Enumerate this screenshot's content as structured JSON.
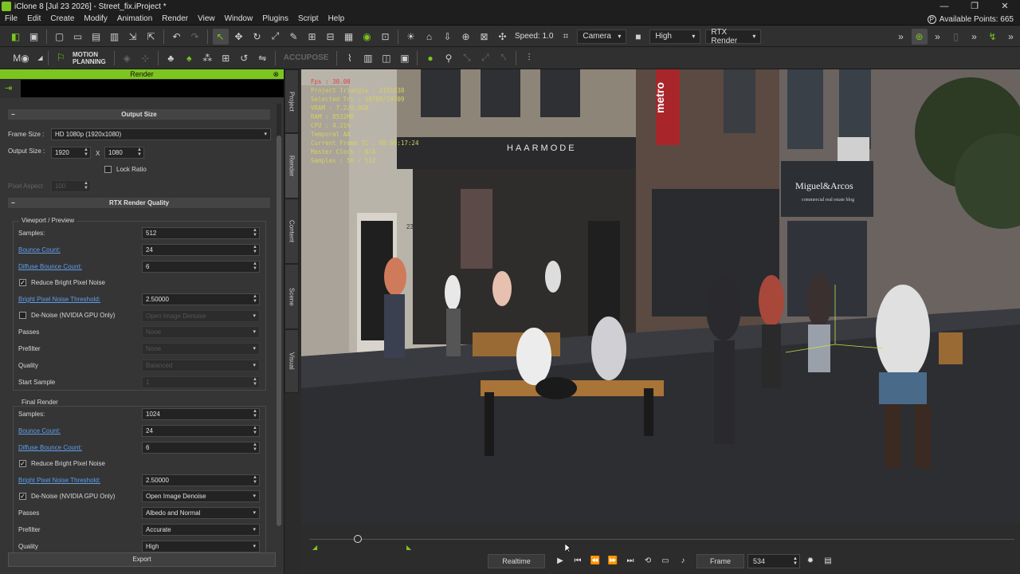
{
  "window": {
    "title": "iClone 8 [Jul 23 2026] - Street_fix.iProject *",
    "controls": [
      "—",
      "❐",
      "✕"
    ]
  },
  "menu": {
    "items": [
      "File",
      "Edit",
      "Create",
      "Modify",
      "Animation",
      "Render",
      "View",
      "Window",
      "Plugins",
      "Script",
      "Help"
    ],
    "points_label": "Available Points: 665",
    "points_icon": "P"
  },
  "toolbar": {
    "speed_label": "Speed: 1.0",
    "camera_value": "Camera",
    "quality_value": "High",
    "render_mode_value": "RTX Render",
    "motion_planning_line1": "MOTION",
    "motion_planning_line2": "PLANNING",
    "accupose_label": "ACCUPOSE"
  },
  "render_panel": {
    "title": "Render",
    "output_size": {
      "header": "Output Size",
      "frame_size_label": "Frame Size :",
      "frame_size_value": "HD 1080p (1920x1080)",
      "output_size_label": "Output Size :",
      "width": "1920",
      "times": "X",
      "height": "1080",
      "lock_ratio_label": "Lock Ratio",
      "pixel_aspect_label": "Pixel Aspect",
      "pixel_aspect_value": "100"
    },
    "rtx_quality": {
      "header": "RTX Render Quality",
      "viewport": {
        "title": "Viewport / Preview",
        "samples_label": "Samples:",
        "samples_value": "512",
        "bounce_label": "Bounce Count:",
        "bounce_value": "24",
        "diffuse_label": "Diffuse Bounce Count:",
        "diffuse_value": "6",
        "reduce_noise_label": "Reduce Bright Pixel Noise",
        "reduce_noise_checked": true,
        "threshold_label": "Bright Pixel Noise Threshold:",
        "threshold_value": "2.50000",
        "denoise_label": "De-Noise (NVIDIA GPU Only)",
        "denoise_checked": false,
        "denoise_value": "Open Image Denoise",
        "passes_label": "Passes",
        "passes_value": "None",
        "prefilter_label": "Prefilter",
        "prefilter_value": "None",
        "quality_label": "Quality",
        "quality_value": "Balanced",
        "start_sample_label": "Start Sample",
        "start_sample_value": "1"
      },
      "final": {
        "title": "Final Render",
        "samples_label": "Samples:",
        "samples_value": "1024",
        "bounce_label": "Bounce Count:",
        "bounce_value": "24",
        "diffuse_label": "Diffuse Bounce Count:",
        "diffuse_value": "6",
        "reduce_noise_label": "Reduce Bright Pixel Noise",
        "reduce_noise_checked": true,
        "threshold_label": "Bright Pixel Noise Threshold:",
        "threshold_value": "2.50000",
        "denoise_label": "De-Noise (NVIDIA GPU Only)",
        "denoise_checked": true,
        "denoise_value": "Open Image Denoise",
        "passes_label": "Passes",
        "passes_value": "Albedo and Normal",
        "prefilter_label": "Prefilter",
        "prefilter_value": "Accurate",
        "quality_label": "Quality",
        "quality_value": "High"
      }
    },
    "export_label": "Export"
  },
  "side_tabs": [
    "Project",
    "Render",
    "Content",
    "Scene",
    "Visual"
  ],
  "viewport": {
    "stats": [
      {
        "text": "Fps : 30.00",
        "red": true
      },
      {
        "text": "Project Triangle : 2191938",
        "red": false
      },
      {
        "text": "Selected Tri : 19709/19709",
        "red": false
      },
      {
        "text": "VRAM : 7.2/8.0GB",
        "red": false
      },
      {
        "text": "RAM : 8532MB",
        "red": false
      },
      {
        "text": "CPU : 4.21%",
        "red": false
      },
      {
        "text": "Temporal AA",
        "red": false
      },
      {
        "text": "Current Frame TC : 00:00:17:24",
        "red": false
      },
      {
        "text": "Master Clock : N/A",
        "red": false
      },
      {
        "text": "Samples : 56 / 512",
        "red": false
      }
    ],
    "signs": {
      "haarmode": "HAARMODE",
      "metro": "metro",
      "miguel": "Miguel&Arcos",
      "miguel_sub": "commercial real estate blog",
      "door_number": "23"
    }
  },
  "timeline": {
    "realtime_label": "Realtime",
    "frame_label": "Frame",
    "frame_value": "534"
  }
}
